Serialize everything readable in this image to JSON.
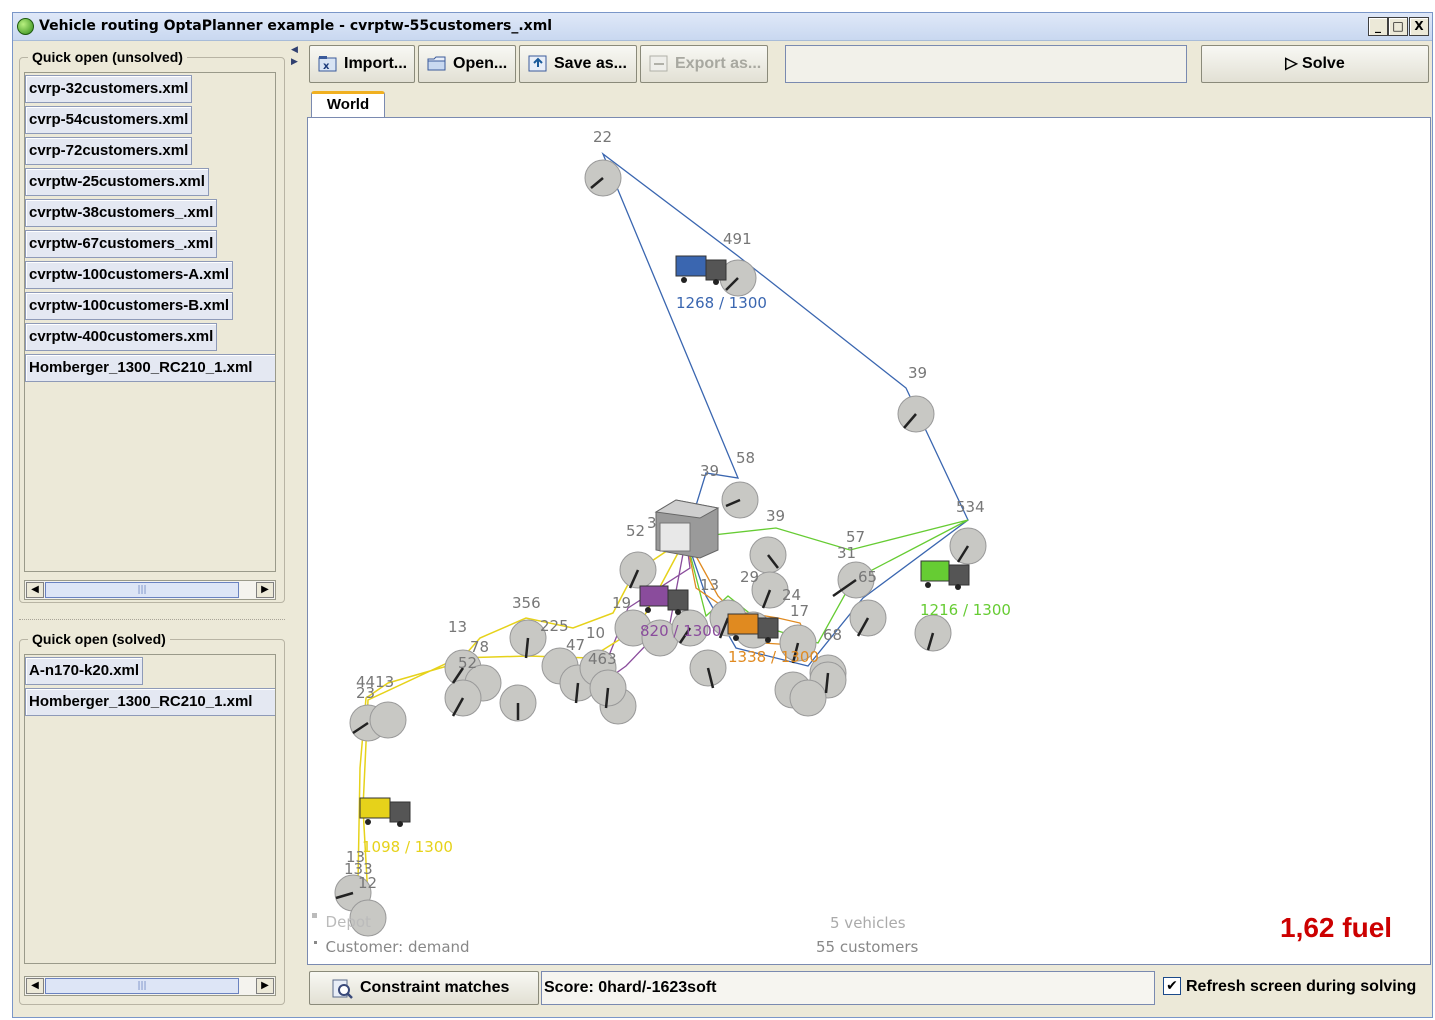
{
  "window": {
    "title": "Vehicle routing OptaPlanner example - cvrptw-55customers_.xml",
    "controls": [
      "_",
      "□",
      "X"
    ]
  },
  "unsolved": {
    "title": "Quick open (unsolved)",
    "files": [
      "cvrp-32customers.xml",
      "cvrp-54customers.xml",
      "cvrp-72customers.xml",
      "cvrptw-25customers.xml",
      "cvrptw-38customers_.xml",
      "cvrptw-67customers_.xml",
      "cvrptw-100customers-A.xml",
      "cvrptw-100customers-B.xml",
      "cvrptw-400customers.xml",
      "Homberger_1300_RC210_1.xml"
    ]
  },
  "solved": {
    "title": "Quick open (solved)",
    "files": [
      "A-n170-k20.xml",
      "Homberger_1300_RC210_1.xml"
    ]
  },
  "toolbar": {
    "import_label": "Import...",
    "open_label": "Open...",
    "saveas_label": "Save as...",
    "exportas_label": "Export as...",
    "solve_label": "▷ Solve"
  },
  "tabs": {
    "world": "World"
  },
  "map": {
    "demand_labels": [
      "22",
      "491",
      "39",
      "39",
      "58",
      "39",
      "52",
      "3",
      "57",
      "31",
      "65",
      "534",
      "356",
      "225",
      "13",
      "78",
      "4413",
      "23",
      "52",
      "10",
      "47",
      "463",
      "19",
      "13",
      "29",
      "24",
      "17",
      "68",
      "13",
      "133",
      "12"
    ],
    "vehicles": [
      {
        "load": "1268 / 1300",
        "color": "#3a66b0"
      },
      {
        "load": "820 / 1300",
        "color": "#8a4c9c"
      },
      {
        "load": "1338 / 1300",
        "color": "#e08a20"
      },
      {
        "load": "1216 / 1300",
        "color": "#66cc33"
      },
      {
        "load": "1098 / 1300",
        "color": "#e6d21a"
      }
    ],
    "legend_depot": "Depot",
    "legend_customer": "Customer: demand",
    "vehicles_count": "5 vehicles",
    "customers_count": "55 customers",
    "fuel": "1,62 fuel"
  },
  "bottom": {
    "constraints_label": "Constraint matches",
    "score": "Score: 0hard/-1623soft",
    "refresh_label": "Refresh screen during solving",
    "refresh_checked": "✔"
  }
}
